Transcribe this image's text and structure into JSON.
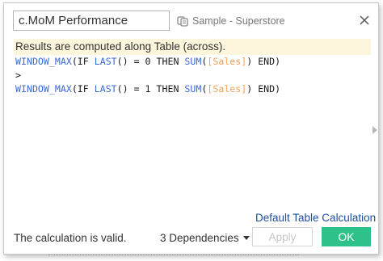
{
  "dialog": {
    "calc_name": "c.MoM Performance",
    "datasource": {
      "icon": "datasource-icon",
      "label": "Sample - Superstore"
    },
    "close_icon": "close-icon"
  },
  "editor": {
    "info": "Results are computed along Table (across).",
    "lines": [
      [
        {
          "t": "WINDOW_MAX",
          "c": "kw"
        },
        {
          "t": "(IF ",
          "c": "txt"
        },
        {
          "t": "LAST",
          "c": "kw"
        },
        {
          "t": "() = 0 THEN ",
          "c": "txt"
        },
        {
          "t": "SUM",
          "c": "kw"
        },
        {
          "t": "(",
          "c": "txt"
        },
        {
          "t": "[Sales]",
          "c": "field"
        },
        {
          "t": ") END)",
          "c": "txt"
        }
      ],
      [
        {
          "t": ">",
          "c": "txt"
        }
      ],
      [
        {
          "t": "WINDOW_MAX",
          "c": "kw"
        },
        {
          "t": "(IF ",
          "c": "txt"
        },
        {
          "t": "LAST",
          "c": "kw"
        },
        {
          "t": "() = 1 THEN ",
          "c": "txt"
        },
        {
          "t": "SUM",
          "c": "kw"
        },
        {
          "t": "(",
          "c": "txt"
        },
        {
          "t": "[Sales]",
          "c": "field"
        },
        {
          "t": ") END)",
          "c": "txt"
        }
      ]
    ]
  },
  "footer": {
    "default_table_calc": "Default Table Calculation",
    "status": "The calculation is valid.",
    "dependencies": "3 Dependencies",
    "apply_label": "Apply",
    "ok_label": "OK"
  },
  "colors": {
    "keyword": "#3a6ad4",
    "field": "#f0a35a",
    "info_bar": "#fdf5dc",
    "ok_button": "#2ec28a",
    "link": "#1f4fa0"
  }
}
